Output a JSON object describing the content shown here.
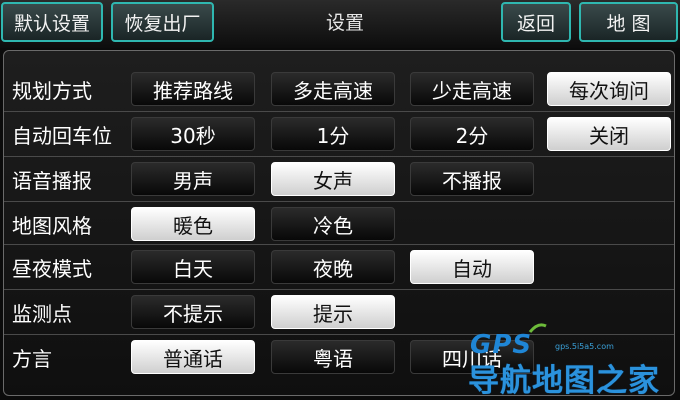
{
  "header": {
    "factory_default": "默认设置",
    "restore_factory": "恢复出厂",
    "title": "设置",
    "back": "返回",
    "map": "地 图"
  },
  "settings": [
    {
      "label": "规划方式",
      "options": [
        "推荐路线",
        "多走高速",
        "少走高速",
        "每次询问"
      ],
      "selected": 3
    },
    {
      "label": "自动回车位",
      "options": [
        "30秒",
        "1分",
        "2分",
        "关闭"
      ],
      "selected": 3
    },
    {
      "label": "语音播报",
      "options": [
        "男声",
        "女声",
        "不播报"
      ],
      "selected": 1
    },
    {
      "label": "地图风格",
      "options": [
        "暖色",
        "冷色"
      ],
      "selected": 0
    },
    {
      "label": "昼夜模式",
      "options": [
        "白天",
        "夜晚",
        "自动"
      ],
      "selected": 2
    },
    {
      "label": "监测点",
      "options": [
        "不提示",
        "提示"
      ],
      "selected": 1
    },
    {
      "label": "方言",
      "options": [
        "普通话",
        "粤语",
        "四川话"
      ],
      "selected": 0
    }
  ],
  "watermark": {
    "logo": "GPS",
    "url": "gps.5i5a5.com",
    "text": "导航地图之家"
  },
  "colors": {
    "accent_border": "#2fb7b0",
    "selected_bg": "#ffffff",
    "unselected_bg": "#111111",
    "watermark": "#2b92dc"
  }
}
